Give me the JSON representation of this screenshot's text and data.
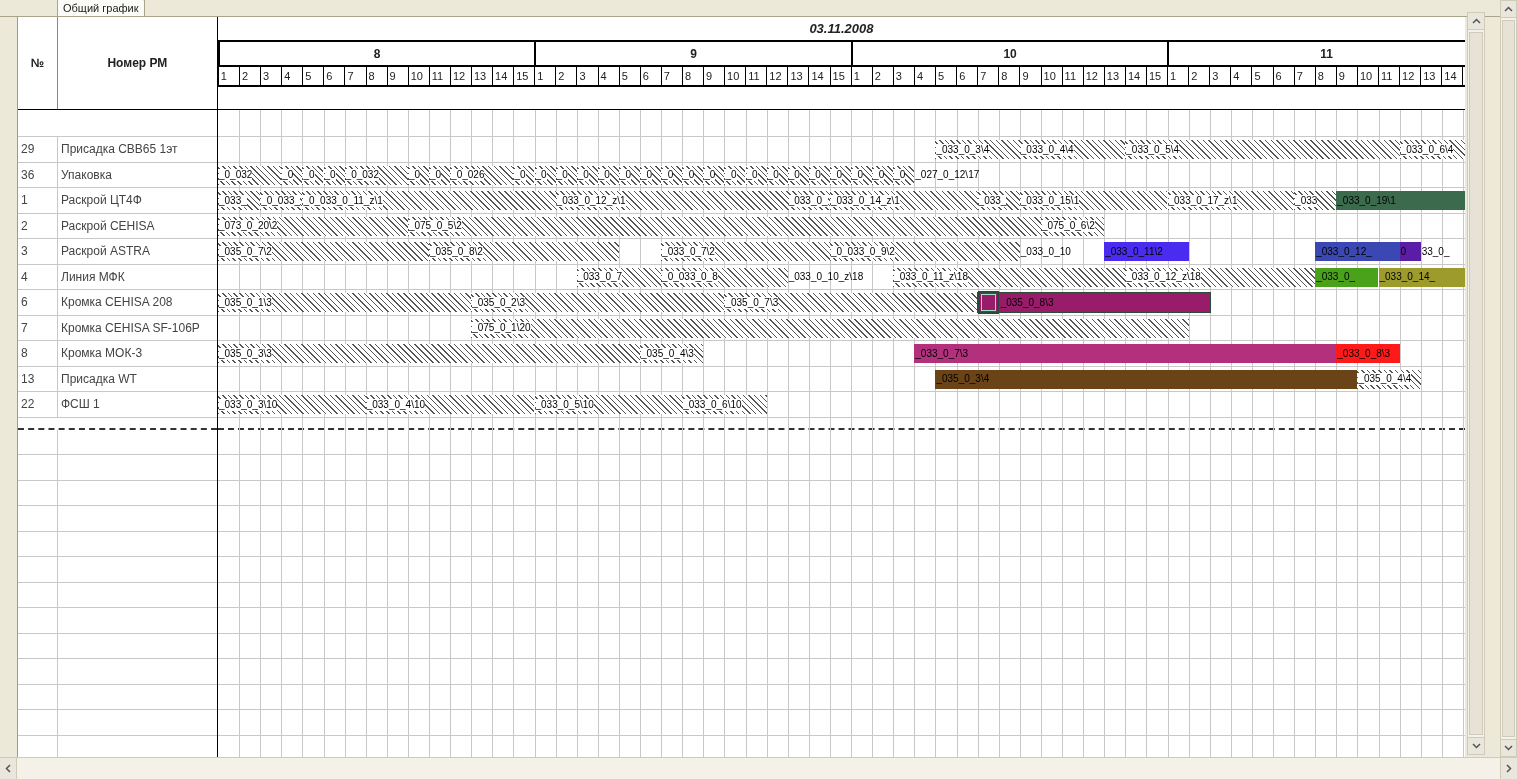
{
  "tab": {
    "label": "Общий график",
    "selected": true
  },
  "columns": {
    "number": "№",
    "name": "Номер РМ"
  },
  "date": "03.11.2008",
  "hours": [
    {
      "label": "8",
      "slots": [
        "1",
        "2",
        "3",
        "4",
        "5",
        "6",
        "7",
        "8",
        "9",
        "10",
        "11",
        "12",
        "13",
        "14",
        "15"
      ]
    },
    {
      "label": "9",
      "slots": [
        "1",
        "2",
        "3",
        "4",
        "5",
        "6",
        "7",
        "8",
        "9",
        "10",
        "11",
        "12",
        "13",
        "14",
        "15"
      ]
    },
    {
      "label": "10",
      "slots": [
        "1",
        "2",
        "3",
        "4",
        "5",
        "6",
        "7",
        "8",
        "9",
        "10",
        "11",
        "12",
        "13",
        "14",
        "15"
      ]
    },
    {
      "label": "11",
      "slots": [
        "1",
        "2",
        "3",
        "4",
        "5",
        "6",
        "7",
        "8",
        "9",
        "10",
        "11",
        "12",
        "13",
        "14"
      ]
    }
  ],
  "rows": [
    {
      "number": "29",
      "name": "Присадка СВВ65 1эт",
      "tasks": [
        {
          "kind": "hatched",
          "label": "_033_0_3\\4",
          "selected": false
        },
        {
          "kind": "hatched",
          "label": "_033_0_4\\4",
          "selected": false
        },
        {
          "kind": "hatched",
          "label": "_033_0_5\\4",
          "selected": false
        },
        {
          "kind": "hatched",
          "label": "_033_0_6\\4",
          "selected": false
        }
      ]
    },
    {
      "number": "36",
      "name": "Упаковка",
      "tasks": [
        {
          "kind": "hatched",
          "label": "_0_032",
          "selected": false
        },
        {
          "kind": "hatched",
          "label": "_0",
          "selected": false
        },
        {
          "kind": "hatched",
          "label": "_0",
          "selected": false
        },
        {
          "kind": "hatched",
          "label": "_0",
          "selected": false
        },
        {
          "kind": "hatched",
          "label": "_0_032",
          "selected": false
        },
        {
          "kind": "hatched",
          "label": "_0",
          "selected": false
        },
        {
          "kind": "hatched",
          "label": "_0",
          "selected": false
        },
        {
          "kind": "hatched",
          "label": "_0_026",
          "selected": false
        },
        {
          "kind": "hatched",
          "label": "_0",
          "selected": false
        },
        {
          "kind": "hatched",
          "label": "_0",
          "selected": false
        },
        {
          "kind": "hatched",
          "label": "_0",
          "selected": false
        },
        {
          "kind": "hatched",
          "label": "_0",
          "selected": false
        },
        {
          "kind": "hatched",
          "label": "_0",
          "selected": false
        },
        {
          "kind": "hatched",
          "label": "_0",
          "selected": false
        },
        {
          "kind": "hatched",
          "label": "_0",
          "selected": false
        },
        {
          "kind": "hatched",
          "label": "_0",
          "selected": false
        },
        {
          "kind": "hatched",
          "label": "_0",
          "selected": false
        },
        {
          "kind": "hatched",
          "label": "_0",
          "selected": false
        },
        {
          "kind": "hatched",
          "label": "_0",
          "selected": false
        },
        {
          "kind": "hatched",
          "label": "_0",
          "selected": false
        },
        {
          "kind": "hatched",
          "label": "_0",
          "selected": false
        },
        {
          "kind": "hatched",
          "label": "_0",
          "selected": false
        },
        {
          "kind": "hatched",
          "label": "_0",
          "selected": false
        },
        {
          "kind": "hatched",
          "label": "_0",
          "selected": false
        },
        {
          "kind": "hatched",
          "label": "_0",
          "selected": false
        },
        {
          "kind": "hatched",
          "label": "_0",
          "selected": false
        },
        {
          "kind": "hatched",
          "label": "_0",
          "selected": false
        },
        {
          "kind": "plain",
          "label": "_027_0_12\\17",
          "selected": false
        }
      ]
    },
    {
      "number": "1",
      "name": "Раскрой ЦТ4Ф",
      "tasks": [
        {
          "kind": "hatched",
          "label": "_033_",
          "selected": false
        },
        {
          "kind": "hatched",
          "label": "_0_033_",
          "selected": false
        },
        {
          "kind": "hatched",
          "label": "_0_033_0_11_z\\1",
          "selected": false
        },
        {
          "kind": "hatched",
          "label": "_033_0_12_z\\1",
          "selected": false
        },
        {
          "kind": "hatched",
          "label": "_033_0_",
          "selected": false
        },
        {
          "kind": "hatched",
          "label": "_033_0_14_z\\1",
          "selected": false
        },
        {
          "kind": "hatched",
          "label": "_033_",
          "selected": false
        },
        {
          "kind": "hatched",
          "label": "_033_0_15\\1",
          "selected": false
        },
        {
          "kind": "hatched",
          "label": "_033_0_17_z\\1",
          "selected": false
        },
        {
          "kind": "hatched",
          "label": "_033",
          "selected": false
        },
        {
          "kind": "solid",
          "color": "#3b6b4c",
          "label": "_033_0_19\\1",
          "selected": false
        }
      ]
    },
    {
      "number": "2",
      "name": "Раскрой CEHISA",
      "tasks": [
        {
          "kind": "hatched",
          "label": "_073_0_20\\2",
          "selected": false
        },
        {
          "kind": "hatched",
          "label": "_075_0_5\\2",
          "selected": false
        },
        {
          "kind": "hatched",
          "label": "_075_0_6\\2",
          "selected": false
        }
      ]
    },
    {
      "number": "3",
      "name": "Раскрой ASTRA",
      "tasks": [
        {
          "kind": "hatched",
          "label": "_035_0_7\\2",
          "selected": false
        },
        {
          "kind": "hatched",
          "label": "_035_0_8\\2",
          "selected": false
        },
        {
          "kind": "hatched",
          "label": "_033_0_7\\2",
          "selected": false
        },
        {
          "kind": "hatched",
          "label": "_0_033_0_9\\2",
          "selected": false
        },
        {
          "kind": "plain",
          "label": "_033_0_10",
          "selected": false
        },
        {
          "kind": "solid",
          "color": "#4a2cf0",
          "label": "_033_0_11\\2",
          "selected": false
        },
        {
          "kind": "solid",
          "color": "#3b48b4",
          "label": "_033_0_12_",
          "selected": false
        },
        {
          "kind": "solid",
          "color": "#5a1ea6",
          "label": "0",
          "selected": false
        },
        {
          "kind": "plain",
          "label": "33_0_",
          "selected": false
        }
      ]
    },
    {
      "number": "4",
      "name": "Линия МФК",
      "tasks": [
        {
          "kind": "hatched",
          "label": "_033_0_7",
          "selected": false
        },
        {
          "kind": "hatched",
          "label": "_0_033_0_8",
          "selected": false
        },
        {
          "kind": "plain",
          "label": "_033_0_10_z\\18",
          "selected": false
        },
        {
          "kind": "hatched",
          "label": "_033_0_11_z\\18",
          "selected": false
        },
        {
          "kind": "hatched",
          "label": "_033_0_12_z\\18",
          "selected": false
        },
        {
          "kind": "solid",
          "color": "#4aa21a",
          "label": "_033_0_",
          "selected": false
        },
        {
          "kind": "solid",
          "color": "#9d9b2c",
          "label": "_033_0_14_",
          "selected": false
        }
      ]
    },
    {
      "number": "6",
      "name": "Кромка CEHISA 208",
      "tasks": [
        {
          "kind": "hatched",
          "label": "_035_0_1\\3",
          "selected": false
        },
        {
          "kind": "hatched",
          "label": "_035_0_2\\3",
          "selected": false
        },
        {
          "kind": "hatched",
          "label": "_035_0_7\\3",
          "selected": false
        },
        {
          "kind": "solid",
          "color": "#981c6a",
          "label": "_035_0_8\\3",
          "selected": true
        }
      ]
    },
    {
      "number": "7",
      "name": "Кромка CEHISA SF-106P",
      "tasks": [
        {
          "kind": "hatched",
          "label": "_075_0_1\\20",
          "selected": false
        }
      ]
    },
    {
      "number": "8",
      "name": "Кромка МОК-3",
      "tasks": [
        {
          "kind": "hatched",
          "label": "_035_0_3\\3",
          "selected": false
        },
        {
          "kind": "hatched",
          "label": "_035_0_4\\3",
          "selected": false
        },
        {
          "kind": "solid",
          "color": "#b2307c",
          "label": "_033_0_7\\3",
          "selected": false
        },
        {
          "kind": "solid",
          "color": "#ff1a1a",
          "label": "_033_0_8\\3",
          "selected": false
        }
      ]
    },
    {
      "number": "13",
      "name": "Присадка WT",
      "tasks": [
        {
          "kind": "solid",
          "color": "#6a4416",
          "label": "_035_0_3\\4",
          "selected": false
        },
        {
          "kind": "hatched",
          "label": "_035_0_4\\4",
          "selected": false
        }
      ]
    },
    {
      "number": "22",
      "name": "ФСШ 1",
      "tasks": [
        {
          "kind": "hatched",
          "label": "_033_0_3\\10",
          "selected": false
        },
        {
          "kind": "hatched",
          "label": "_033_0_4\\10",
          "selected": false
        },
        {
          "kind": "hatched",
          "label": "_033_0_5\\10",
          "selected": false
        },
        {
          "kind": "hatched",
          "label": "_033_0_6\\10",
          "selected": false
        }
      ]
    }
  ]
}
